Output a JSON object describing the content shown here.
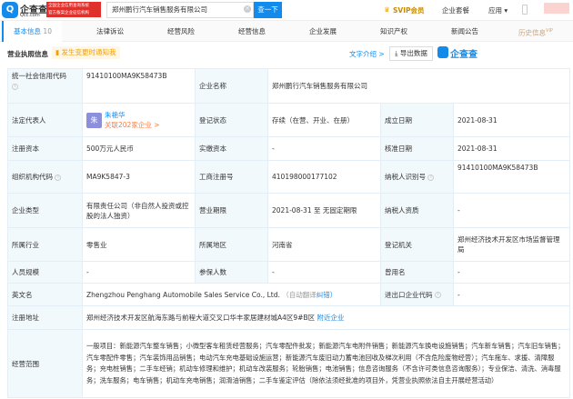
{
  "header": {
    "logo_text": "企查查",
    "logo_sub": "Qcc.com",
    "badge_line1": "全国企业信用查询系统",
    "badge_line2": "官方备案企业征信机构",
    "search_value": "郑州鹏行汽车销售服务有限公司",
    "search_button": "查一下",
    "svip": "SVIP会员",
    "package": "企业套餐",
    "apps": "应用"
  },
  "tabs": [
    {
      "label": "基本信息",
      "count": "10"
    },
    {
      "label": "法律诉讼"
    },
    {
      "label": "经营风险"
    },
    {
      "label": "经营信息"
    },
    {
      "label": "企业发展"
    },
    {
      "label": "知识产权"
    },
    {
      "label": "新闻公告"
    },
    {
      "label": "历史信息",
      "tag": "VIP"
    }
  ],
  "section": {
    "title": "营业执照信息",
    "notify": "发生变更时通知我",
    "text_intro": "文字介绍 >",
    "export": "导出数据",
    "brand": "企查查"
  },
  "rows": {
    "credit_code_label": "统一社会信用代码",
    "credit_code": "91410100MA9K58473B",
    "name_label": "企业名称",
    "name": "郑州鹏行汽车销售服务有限公司",
    "legal_label": "法定代表人",
    "legal_avatar": "朱",
    "legal_name": "朱艳华",
    "legal_related": "关联202家企业 >",
    "status_label": "登记状态",
    "status": "存续（在营、开业、在册）",
    "found_label": "成立日期",
    "found": "2021-08-31",
    "capital_label": "注册资本",
    "capital": "500万元人民币",
    "paid_label": "实缴资本",
    "paid": "-",
    "approve_label": "核准日期",
    "approve": "2021-08-31",
    "org_label": "组织机构代码",
    "org": "MA9K5847-3",
    "reg_no_label": "工商注册号",
    "reg_no": "410198000177102",
    "tax_label": "纳税人识别号",
    "tax": "91410100MA9K58473B",
    "type_label": "企业类型",
    "type": "有限责任公司（非自然人投资或控股的法人独资）",
    "term_label": "营业期限",
    "term": "2021-08-31 至 无固定期限",
    "taxq_label": "纳税人资质",
    "taxq": "-",
    "industry_label": "所属行业",
    "industry": "零售业",
    "region_label": "所属地区",
    "region": "河南省",
    "authority_label": "登记机关",
    "authority": "郑州经济技术开发区市场监督管理局",
    "staff_label": "人员规模",
    "staff": "-",
    "insured_label": "参保人数",
    "insured": "-",
    "former_label": "曾用名",
    "former": "-",
    "en_label": "英文名",
    "en": "Zhengzhou Penghang Automobile Sales Service Co., Ltd.",
    "en_auto": "（自动翻译",
    "en_fix": "纠错）",
    "ie_label": "进出口企业代码",
    "ie": "-",
    "addr_label": "注册地址",
    "addr": "郑州经济技术开发区航海东路与前程大道交叉口华丰家居建材城A4区9#B区",
    "addr_link": "附近企业",
    "scope_label": "经营范围",
    "scope": "一般项目：新能源汽车整车销售；小微型客车租赁经营服务；汽车零配件批发；新能源汽车电附件销售；新能源汽车换电设施销售；汽车新车销售；汽车旧车销售；汽车零配件零售；汽车装饰用品销售；电动汽车充电基础设施运营；新能源汽车废旧动力蓄电池回收及梯次利用（不含危险废物经营）；汽车拖车、求援、清障服务；充电桩销售；二手车经销；机动车修理和维护；机动车改装服务；轮胎销售；电池销售；信息咨询服务（不含许可类信息咨询服务）；专业保洁、清洗、消毒服务；洗车服务；电车销售；机动车充电销售；润滑油销售；二手车鉴定评估（除依法须经批准的项目外，凭营业执照依法自主开展经营活动）"
  },
  "colors": {
    "accent": "#128bed",
    "orange": "#fd7b3e",
    "label_bg": "#f2f9fc"
  }
}
